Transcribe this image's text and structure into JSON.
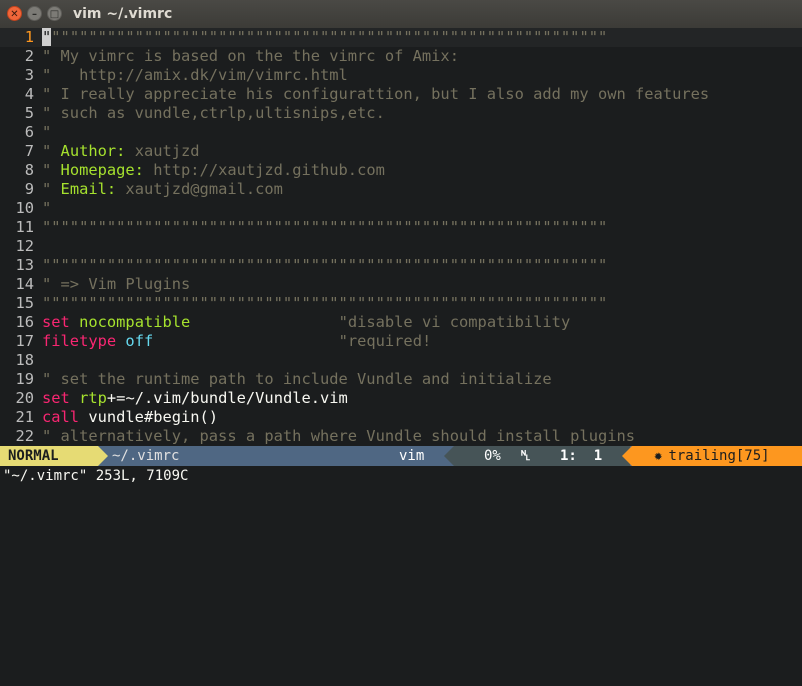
{
  "window": {
    "title": "vim ~/.vimrc"
  },
  "editor": {
    "lines": [
      {
        "n": "1",
        "parts": [
          [
            "cur",
            "\""
          ],
          [
            "c",
            "\"\"\"\"\"\"\"\"\"\"\"\"\"\"\"\"\"\"\"\"\"\"\"\"\"\"\"\"\"\"\"\"\"\"\"\"\"\"\"\"\"\"\"\"\"\"\"\"\"\"\"\"\"\"\"\"\"\"\"\""
          ]
        ]
      },
      {
        "n": "2",
        "parts": [
          [
            "c",
            "\" My vimrc is based on the the vimrc of Amix:"
          ]
        ]
      },
      {
        "n": "3",
        "parts": [
          [
            "c",
            "\"   http://amix.dk/vim/vimrc.html"
          ]
        ]
      },
      {
        "n": "4",
        "parts": [
          [
            "c",
            "\" I really appreciate his configurattion, but I also add my own features"
          ]
        ]
      },
      {
        "n": "5",
        "parts": [
          [
            "c",
            "\" such as vundle,ctrlp,ultisnips,etc."
          ]
        ]
      },
      {
        "n": "6",
        "parts": [
          [
            "c",
            "\""
          ]
        ]
      },
      {
        "n": "7",
        "parts": [
          [
            "c",
            "\" "
          ],
          [
            "g",
            "Author:"
          ],
          [
            "c",
            " xautjzd"
          ]
        ]
      },
      {
        "n": "8",
        "parts": [
          [
            "c",
            "\" "
          ],
          [
            "g",
            "Homepage:"
          ],
          [
            "c",
            " http://xautjzd.github.com"
          ]
        ]
      },
      {
        "n": "9",
        "parts": [
          [
            "c",
            "\" "
          ],
          [
            "g",
            "Email:"
          ],
          [
            "c",
            " xautjzd@gmail.com"
          ]
        ]
      },
      {
        "n": "10",
        "parts": [
          [
            "c",
            "\""
          ]
        ]
      },
      {
        "n": "11",
        "parts": [
          [
            "c",
            "\"\"\"\"\"\"\"\"\"\"\"\"\"\"\"\"\"\"\"\"\"\"\"\"\"\"\"\"\"\"\"\"\"\"\"\"\"\"\"\"\"\"\"\"\"\"\"\"\"\"\"\"\"\"\"\"\"\"\"\"\""
          ]
        ]
      },
      {
        "n": "12",
        "parts": []
      },
      {
        "n": "13",
        "parts": [
          [
            "c",
            "\"\"\"\"\"\"\"\"\"\"\"\"\"\"\"\"\"\"\"\"\"\"\"\"\"\"\"\"\"\"\"\"\"\"\"\"\"\"\"\"\"\"\"\"\"\"\"\"\"\"\"\"\"\"\"\"\"\"\"\"\""
          ]
        ]
      },
      {
        "n": "14",
        "parts": [
          [
            "c",
            "\" => Vim Plugins"
          ]
        ]
      },
      {
        "n": "15",
        "parts": [
          [
            "c",
            "\"\"\"\"\"\"\"\"\"\"\"\"\"\"\"\"\"\"\"\"\"\"\"\"\"\"\"\"\"\"\"\"\"\"\"\"\"\"\"\"\"\"\"\"\"\"\"\"\"\"\"\"\"\"\"\"\"\"\"\"\""
          ]
        ]
      },
      {
        "n": "16",
        "parts": [
          [
            "k",
            "set"
          ],
          [
            "p",
            " "
          ],
          [
            "g",
            "nocompatible"
          ],
          [
            "p",
            "                "
          ],
          [
            "c",
            "\"disable vi compatibility"
          ]
        ]
      },
      {
        "n": "17",
        "parts": [
          [
            "k",
            "filetype"
          ],
          [
            "p",
            " "
          ],
          [
            "b",
            "off"
          ],
          [
            "p",
            "                    "
          ],
          [
            "c",
            "\"required!"
          ]
        ]
      },
      {
        "n": "18",
        "parts": []
      },
      {
        "n": "19",
        "parts": [
          [
            "c",
            "\" set the runtime path to include Vundle and initialize"
          ]
        ]
      },
      {
        "n": "20",
        "parts": [
          [
            "k",
            "set"
          ],
          [
            "p",
            " "
          ],
          [
            "g",
            "rtp"
          ],
          [
            "p",
            "+=~/.vim/bundle/Vundle.vim"
          ]
        ]
      },
      {
        "n": "21",
        "parts": [
          [
            "k",
            "call"
          ],
          [
            "p",
            " vundle#begin()"
          ]
        ]
      },
      {
        "n": "22",
        "parts": [
          [
            "c",
            "\" alternatively, pass a path where Vundle should install plugins"
          ]
        ]
      }
    ]
  },
  "status": {
    "mode": "NORMAL",
    "file": "~/.vimrc",
    "filetype": "vim",
    "percent": "0%",
    "line_symbol": "␤",
    "position": "1:  1",
    "warning_icon": "✹",
    "warning": "trailing[75]"
  },
  "cmdline": {
    "text": "\"~/.vimrc\" 253L, 7109C"
  },
  "colors": {
    "background": "#1b1d1e",
    "comment": "#75715e",
    "keyword": "#f92672",
    "option": "#a6e22e",
    "constant": "#66d9ef",
    "mode_bg": "#e6db74",
    "status_bg": "#4f6783",
    "warning_bg": "#fd971f"
  }
}
